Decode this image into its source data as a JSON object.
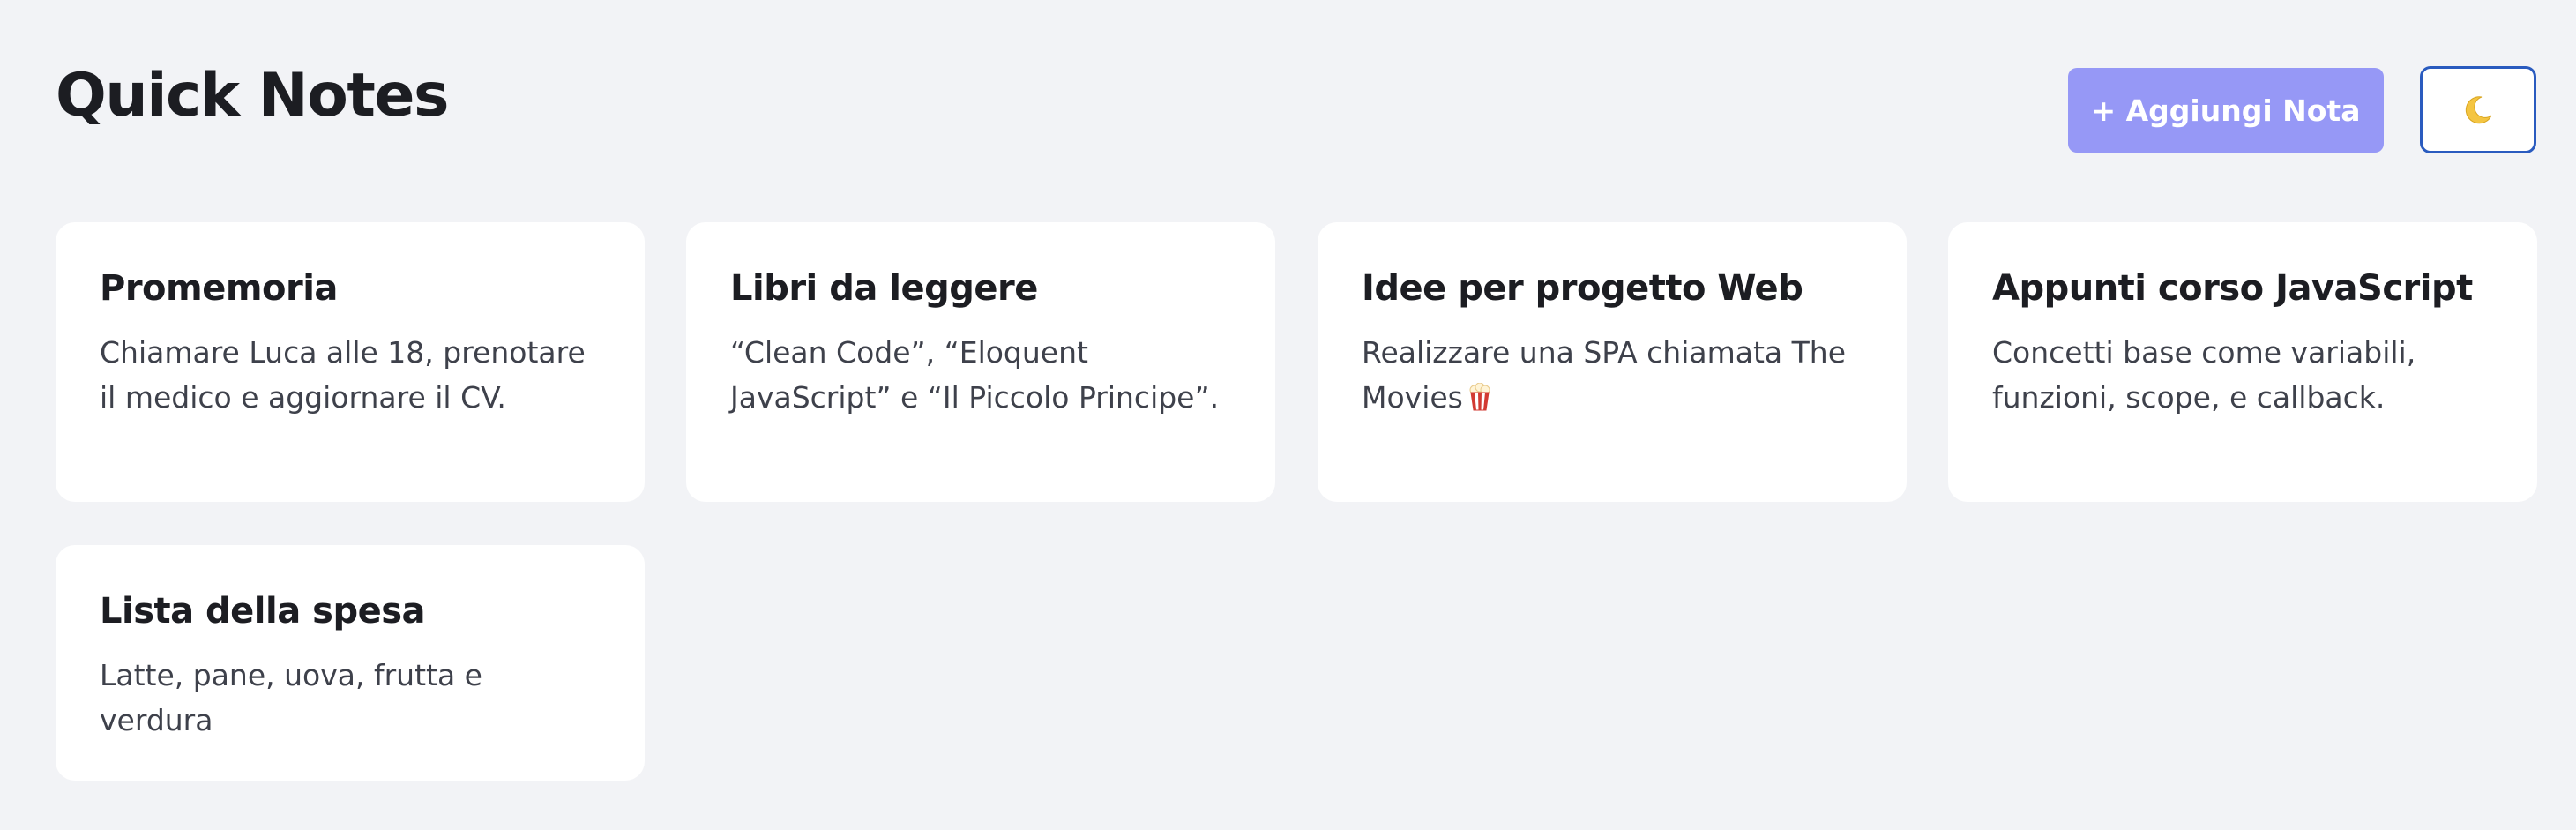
{
  "header": {
    "title": "Quick Notes",
    "add_button_label": "+ Aggiungi Nota",
    "theme_toggle_icon": "moon-icon"
  },
  "notes": [
    {
      "title": "Promemoria",
      "body": "Chiamare Luca alle 18, prenotare il medico e aggiornare il CV."
    },
    {
      "title": "Libri da leggere",
      "body": "“Clean Code”, “Eloquent JavaScript” e “Il Piccolo Principe”."
    },
    {
      "title": "Idee per progetto Web",
      "body": "Realizzare una SPA chiamata The Movies",
      "trailing_icon": "popcorn-icon"
    },
    {
      "title": "Appunti corso JavaScript",
      "body": "Concetti base come variabili, funzioni, scope, e callback."
    },
    {
      "title": "Lista della spesa",
      "body": "Latte, pane, uova, frutta e verdura"
    }
  ],
  "colors": {
    "background": "#f2f3f6",
    "card": "#ffffff",
    "accent_button": "#9698f6",
    "toggle_border": "#2a5bbf",
    "title_text": "#1c1d22",
    "body_text": "#3e414b"
  }
}
